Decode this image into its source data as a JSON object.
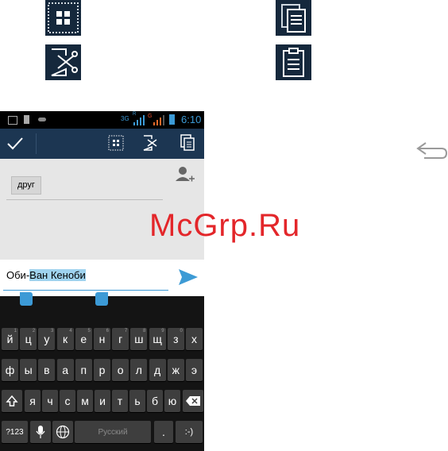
{
  "status_bar": {
    "time": "6:10",
    "network_3g": "3G",
    "network_r": "R",
    "network_g": "G"
  },
  "recipient": {
    "chip_label": "друг"
  },
  "compose": {
    "text_before": "Оби-",
    "text_selected": "Ван Кеноби"
  },
  "keyboard": {
    "row1": [
      {
        "label": "й",
        "hint": "1"
      },
      {
        "label": "ц",
        "hint": "2"
      },
      {
        "label": "у",
        "hint": "3"
      },
      {
        "label": "к",
        "hint": "4"
      },
      {
        "label": "е",
        "hint": "5"
      },
      {
        "label": "н",
        "hint": "6"
      },
      {
        "label": "г",
        "hint": "7"
      },
      {
        "label": "ш",
        "hint": "8"
      },
      {
        "label": "щ",
        "hint": "9"
      },
      {
        "label": "з",
        "hint": "0"
      },
      {
        "label": "х",
        "hint": ""
      }
    ],
    "row2": [
      "ф",
      "ы",
      "в",
      "а",
      "п",
      "р",
      "о",
      "л",
      "д",
      "ж",
      "э"
    ],
    "row3": [
      "я",
      "ч",
      "с",
      "м",
      "и",
      "т",
      "ь",
      "б",
      "ю"
    ],
    "mode_label": "?123",
    "space_label": "Русский",
    "period_label": ".",
    "smiley_label": ":-)"
  },
  "watermark": "McGrp.Ru",
  "colors": {
    "action_bar": "#1c3652",
    "selection": "#9fd3ef",
    "handle": "#3c9ad6",
    "send": "#3d9bd5",
    "watermark": "#e3262a"
  }
}
